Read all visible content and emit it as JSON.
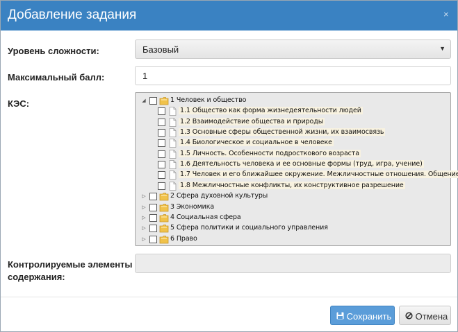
{
  "dialog": {
    "title": "Добавление задания",
    "close_glyph": "×"
  },
  "form": {
    "difficulty_label": "Уровень сложности:",
    "difficulty_value": "Базовый",
    "max_score_label": "Максимальный балл:",
    "max_score_value": "1",
    "kes_label": "КЭС:",
    "controlled_label_line1": "Контролируемые элементы",
    "controlled_label_line2": "содержания:",
    "controlled_value": ""
  },
  "tree": {
    "nodes": [
      {
        "text": "1 Человек и общество",
        "type": "folder",
        "expanded": true,
        "level": 0,
        "checked": false
      },
      {
        "text": "1.1 Общество как форма жизнедеятельности людей",
        "type": "file",
        "level": 1,
        "checked": false
      },
      {
        "text": "1.2 Взаимодействие общества и природы",
        "type": "file",
        "level": 1,
        "checked": false
      },
      {
        "text": "1.3 Основные сферы общественной жизни, их взаимосвязь",
        "type": "file",
        "level": 1,
        "checked": false
      },
      {
        "text": "1.4 Биологическое и социальное в человеке",
        "type": "file",
        "level": 1,
        "checked": false
      },
      {
        "text": "1.5 Личность. Особенности подросткового возраста",
        "type": "file",
        "level": 1,
        "checked": false
      },
      {
        "text": "1.6 Деятельность человека и ее основные формы (труд, игра, учение)",
        "type": "file",
        "level": 1,
        "checked": false
      },
      {
        "text": "1.7 Человек и его ближайшее окружение. Межличностные отношения. Общение",
        "type": "file",
        "level": 1,
        "checked": false
      },
      {
        "text": "1.8 Межличностные конфликты, их конструктивное разрешение",
        "type": "file",
        "level": 1,
        "checked": false
      },
      {
        "text": "2 Сфера духовной культуры",
        "type": "folder",
        "expanded": false,
        "level": 0,
        "checked": false
      },
      {
        "text": "3 Экономика",
        "type": "folder",
        "expanded": false,
        "level": 0,
        "checked": false
      },
      {
        "text": "4 Социальная сфера",
        "type": "folder",
        "expanded": false,
        "level": 0,
        "checked": false
      },
      {
        "text": "5 Сфера политики и социального управления",
        "type": "folder",
        "expanded": false,
        "level": 0,
        "checked": false
      },
      {
        "text": "6 Право",
        "type": "folder",
        "expanded": false,
        "level": 0,
        "checked": false
      }
    ],
    "expanded_arrow": "◢",
    "collapsed_arrow": "▷"
  },
  "buttons": {
    "save_label": "Сохранить",
    "cancel_label": "Отмена"
  },
  "icons": {
    "folder": "folder-icon",
    "file": "file-icon",
    "save": "save-icon",
    "cancel": "ban-icon",
    "select_caret": "caret-down-icon"
  },
  "colors": {
    "header": "#3a82c2",
    "save_button": "#5b9dd9",
    "tree_background": "#e9e9e9"
  }
}
